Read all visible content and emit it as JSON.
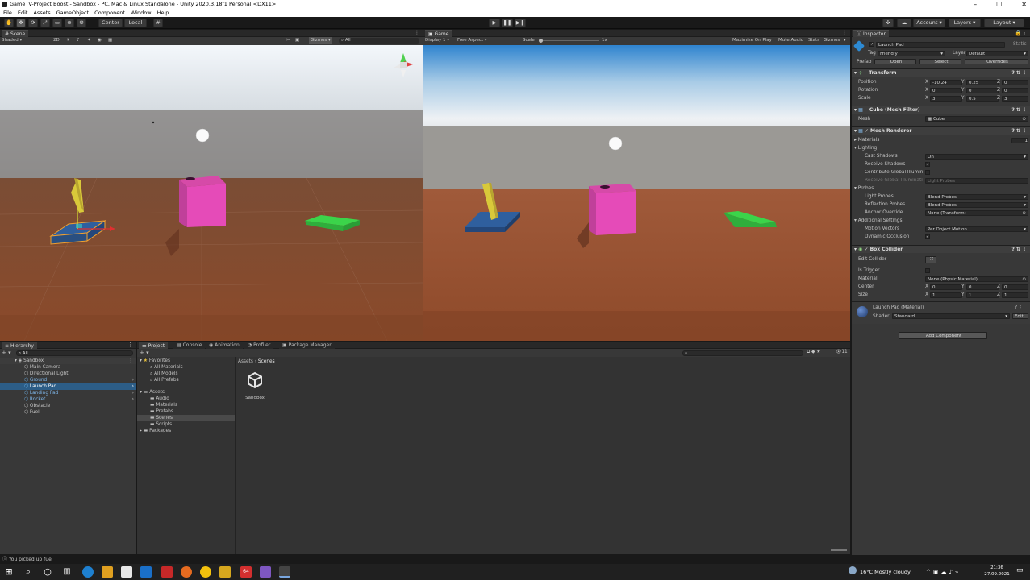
{
  "window": {
    "title": "GameTV-Project Boost - Sandbox - PC, Mac & Linux Standalone - Unity 2020.3.18f1 Personal <DX11>",
    "controls": [
      "–",
      "☐",
      "✕"
    ]
  },
  "menu": [
    "File",
    "Edit",
    "Assets",
    "GameObject",
    "Component",
    "Window",
    "Help"
  ],
  "toolbar": {
    "pivot": "Center",
    "space": "Local",
    "account": "Account",
    "layers": "Layers",
    "layout": "Layout"
  },
  "scene_view": {
    "tab": "Scene",
    "shading": "Shaded",
    "mode_2d": "2D",
    "gizmos": "Gizmos",
    "search_placeholder": "All"
  },
  "game_view": {
    "tab": "Game",
    "display": "Display 1",
    "aspect": "Free Aspect",
    "scale_label": "Scale",
    "scale_value": "1x",
    "maximize": "Maximize On Play",
    "mute": "Mute Audio",
    "stats": "Stats",
    "gizmos": "Gizmos"
  },
  "hierarchy": {
    "tab": "Hierarchy",
    "search_placeholder": "All",
    "scene": "Sandbox",
    "items": [
      {
        "label": "Main Camera",
        "prefab": false,
        "selected": false
      },
      {
        "label": "Directional Light",
        "prefab": false,
        "selected": false
      },
      {
        "label": "Ground",
        "prefab": true,
        "selected": false
      },
      {
        "label": "Launch Pad",
        "prefab": true,
        "selected": true
      },
      {
        "label": "Landing Pad",
        "prefab": true,
        "selected": false
      },
      {
        "label": "Rocket",
        "prefab": true,
        "selected": false
      },
      {
        "label": "Obstacle",
        "prefab": false,
        "selected": false
      },
      {
        "label": "Fuel",
        "prefab": false,
        "selected": false
      }
    ]
  },
  "project": {
    "tabs": [
      "Project",
      "Console",
      "Animation",
      "Profiler",
      "Package Manager"
    ],
    "favorites_label": "Favorites",
    "favorites": [
      "All Materials",
      "All Models",
      "All Prefabs"
    ],
    "assets_label": "Assets",
    "folders": [
      "Audio",
      "Materials",
      "Prefabs",
      "Scenes",
      "Scripts"
    ],
    "packages_label": "Packages",
    "breadcrumb": [
      "Assets",
      "Scenes"
    ],
    "file": "Sandbox",
    "count_badge": "11"
  },
  "inspector": {
    "tab": "Inspector",
    "object_name": "Launch Pad",
    "static_label": "Static",
    "tag_label": "Tag",
    "tag": "Friendly",
    "layer_label": "Layer",
    "layer": "Default",
    "prefab_label": "Prefab",
    "prefab_open": "Open",
    "prefab_select": "Select",
    "prefab_overrides": "Overrides",
    "transform": {
      "title": "Transform",
      "position_label": "Position",
      "position": [
        "-10.24",
        "0.25",
        "0"
      ],
      "rotation_label": "Rotation",
      "rotation": [
        "0",
        "0",
        "0"
      ],
      "scale_label": "Scale",
      "scale": [
        "3",
        "0.5",
        "3"
      ]
    },
    "mesh_filter": {
      "title": "Cube (Mesh Filter)",
      "mesh_label": "Mesh",
      "mesh": "Cube"
    },
    "mesh_renderer": {
      "title": "Mesh Renderer",
      "materials_label": "Materials",
      "materials_count": "1",
      "lighting_label": "Lighting",
      "cast_shadows_label": "Cast Shadows",
      "cast_shadows": "On",
      "receive_shadows_label": "Receive Shadows",
      "contribute_gi_label": "Contribute Global Illumination",
      "receive_gi_label": "Receive Global Illumination",
      "receive_gi": "Light Probes",
      "probes_label": "Probes",
      "light_probes_label": "Light Probes",
      "light_probes": "Blend Probes",
      "reflection_probes_label": "Reflection Probes",
      "reflection_probes": "Blend Probes",
      "anchor_override_label": "Anchor Override",
      "anchor_override": "None (Transform)",
      "additional_label": "Additional Settings",
      "motion_vectors_label": "Motion Vectors",
      "motion_vectors": "Per Object Motion",
      "dynamic_occlusion_label": "Dynamic Occlusion"
    },
    "box_collider": {
      "title": "Box Collider",
      "edit_label": "Edit Collider",
      "trigger_label": "Is Trigger",
      "material_label": "Material",
      "material": "None (Physic Material)",
      "center_label": "Center",
      "center": [
        "0",
        "0",
        "0"
      ],
      "size_label": "Size",
      "size": [
        "1",
        "1",
        "1"
      ]
    },
    "material": {
      "title": "Launch Pad (Material)",
      "shader_label": "Shader",
      "shader": "Standard",
      "edit": "Edit..."
    },
    "add_component": "Add Component"
  },
  "status_message": "You picked up fuel",
  "taskbar": {
    "weather": "16°C  Mostly cloudy",
    "time": "21:36",
    "date": "27.09.2021"
  },
  "colors": {
    "launch_pad": "#2f5f9e",
    "rocket": "#d9c93a",
    "obstacle": "#e54bb8",
    "landing_pad": "#3bd44a",
    "ground": "#8a4a2e",
    "selection": "#2c5d87"
  }
}
